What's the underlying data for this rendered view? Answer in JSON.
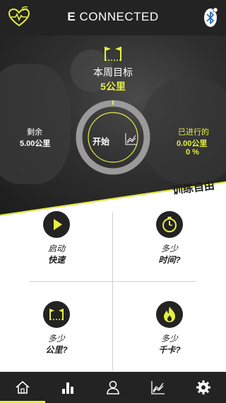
{
  "header": {
    "title_bold": "E",
    "title_rest": " CONNECTED",
    "logo_icon": "heart-wifi-icon",
    "bluetooth_icon": "bluetooth-icon"
  },
  "goal": {
    "icon": "flags-icon",
    "label": "本周目标",
    "value": "5公里"
  },
  "start": {
    "label": "开始",
    "icon": "chart-line-icon"
  },
  "remaining": {
    "label": "剩余",
    "value": "5.00公里"
  },
  "progress": {
    "label": "已进行的",
    "value": "0.00公里",
    "percent": "0 %",
    "fraction": 0
  },
  "free_training": "训练自由",
  "tiles": [
    {
      "icon": "play-icon",
      "line1": "启动",
      "line2": "快速"
    },
    {
      "icon": "stopwatch-icon",
      "line1": "多少",
      "line2": "时间?"
    },
    {
      "icon": "flags-icon",
      "line1": "多少",
      "line2": "公里?"
    },
    {
      "icon": "flame-icon",
      "line1": "多少",
      "line2": "千卡?"
    }
  ],
  "nav": [
    {
      "icon": "home-icon",
      "active": true
    },
    {
      "icon": "bar-chart-icon",
      "active": false
    },
    {
      "icon": "user-icon",
      "active": false
    },
    {
      "icon": "line-chart-icon",
      "active": false
    },
    {
      "icon": "gear-icon",
      "active": false
    }
  ],
  "colors": {
    "accent": "#e7ef3d",
    "dark": "#232323",
    "ring": "#9a9a9a"
  }
}
